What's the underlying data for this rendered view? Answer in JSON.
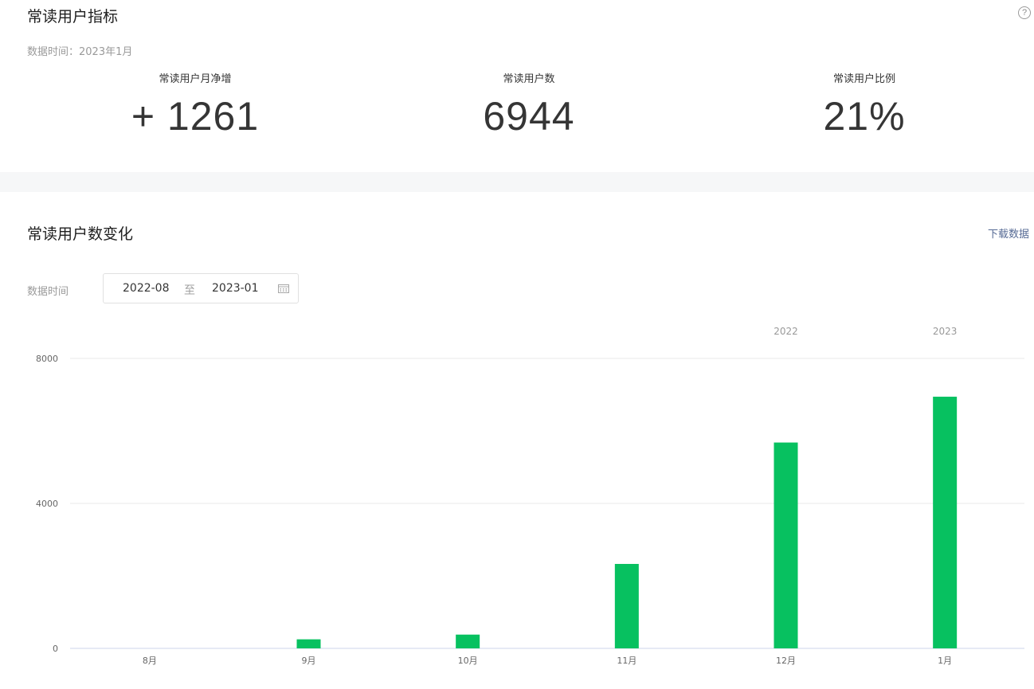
{
  "overview": {
    "title": "常读用户指标",
    "help_icon": "question-circle-icon",
    "data_time": "数据时间：2023年1月",
    "metrics": [
      {
        "label": "常读用户月净增",
        "value": "+ 1261"
      },
      {
        "label": "常读用户数",
        "value": "6944"
      },
      {
        "label": "常读用户比例",
        "value": "21%"
      }
    ]
  },
  "trend": {
    "title": "常读用户数变化",
    "download_label": "下载数据",
    "filter_label": "数据时间",
    "date_start": "2022-08",
    "date_separator": "至",
    "date_end": "2023-01",
    "calendar_icon": "calendar-icon"
  },
  "colors": {
    "bar": "#07c160",
    "grid": "#e8e8e8",
    "axis": "#ccd6eb",
    "link": "#576b95"
  },
  "chart_data": {
    "type": "bar",
    "categories": [
      "8月",
      "9月",
      "10月",
      "11月",
      "12月",
      "1月"
    ],
    "year_labels": [
      {
        "category": "12月",
        "label": "2022"
      },
      {
        "category": "1月",
        "label": "2023"
      }
    ],
    "values": [
      0,
      250,
      380,
      2330,
      5680,
      6944
    ],
    "yticks": [
      0,
      4000,
      8000
    ],
    "ylim": [
      0,
      8000
    ],
    "grid": true
  }
}
